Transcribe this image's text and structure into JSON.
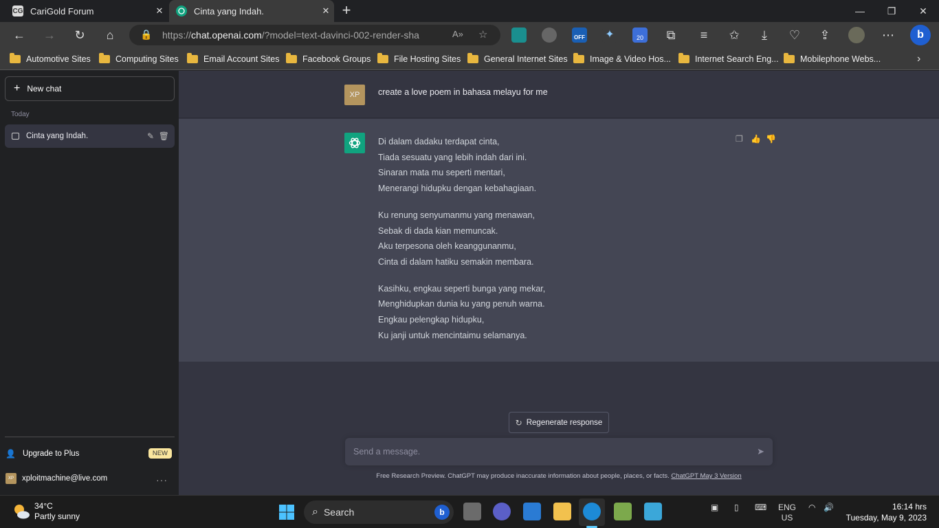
{
  "browser": {
    "tabs": [
      {
        "title": "CariGold Forum",
        "favicon": "CG"
      },
      {
        "title": "Cinta yang Indah.",
        "favicon": "openai"
      }
    ],
    "url": {
      "prefix": "https://",
      "domain": "chat.openai.com",
      "path": "/?model=text-davinci-002-render-sha"
    },
    "extension_badges": {
      "off": "OFF",
      "count": "20"
    },
    "bookmarks": [
      "Automotive Sites",
      "Computing Sites",
      "Email Account Sites",
      "Facebook Groups",
      "File Hosting Sites",
      "General Internet Sites",
      "Image & Video Hos...",
      "Internet Search Eng...",
      "Mobilephone Webs..."
    ]
  },
  "sidebar": {
    "new_chat": "New chat",
    "section": "Today",
    "conversations": [
      "Cinta yang Indah."
    ],
    "upgrade": "Upgrade to Plus",
    "new_badge": "NEW",
    "user_email": "xploitmachine@live.com",
    "user_initials": "XP"
  },
  "chat": {
    "user_initials": "XP",
    "user_message": "create a love poem in bahasa melayu for me",
    "response": [
      [
        "Di dalam dadaku terdapat cinta,",
        "Tiada sesuatu yang lebih indah dari ini.",
        "Sinaran mata mu seperti mentari,",
        "Menerangi hidupku dengan kebahagiaan."
      ],
      [
        "Ku renung senyumanmu yang menawan,",
        "Sebak di dada kian memuncak.",
        "Aku terpesona oleh keanggunanmu,",
        "Cinta di dalam hatiku semakin membara."
      ],
      [
        "Kasihku, engkau seperti bunga yang mekar,",
        "Menghidupkan dunia ku yang penuh warna.",
        "Engkau pelengkap hidupku,",
        "Ku janji untuk mencintaimu selamanya."
      ]
    ],
    "regenerate": "Regenerate response",
    "input_placeholder": "Send a message.",
    "disclaimer": "Free Research Preview. ChatGPT may produce inaccurate information about people, places, or facts.",
    "version_link": "ChatGPT May 3 Version"
  },
  "taskbar": {
    "temperature": "34°C",
    "weather": "Partly sunny",
    "search": "Search",
    "language": "ENG",
    "region": "US",
    "time": "16:14 hrs",
    "date": "Tuesday, May 9, 2023"
  },
  "colors": {
    "accent": "#10a37f",
    "sidebar_bg": "#202123",
    "main_bg": "#343541",
    "response_bg": "#444654"
  }
}
